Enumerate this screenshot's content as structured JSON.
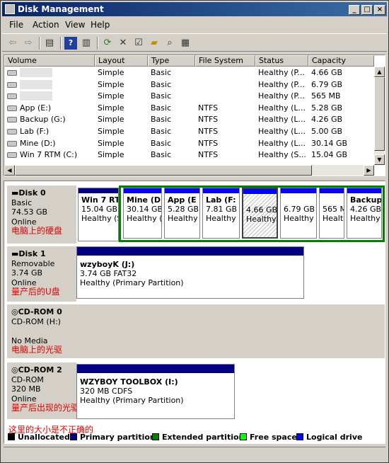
{
  "window": {
    "title": "Disk Management",
    "controls": [
      "_",
      "□",
      "×"
    ]
  },
  "menu": [
    "File",
    "Action",
    "View",
    "Help"
  ],
  "toolbar": [
    "back-arrow-icon",
    "forward-arrow-icon",
    "console-tree-icon",
    "help-icon",
    "properties-pane-icon",
    "refresh-icon",
    "delete-icon",
    "properties-icon",
    "open-folder-icon",
    "search-icon",
    "settings-icon"
  ],
  "columns": [
    "Volume",
    "Layout",
    "Type",
    "File System",
    "Status",
    "Capacity"
  ],
  "volumes": [
    {
      "name": "",
      "layout": "Simple",
      "type": "Basic",
      "fs": "",
      "status": "Healthy (P...",
      "capacity": "4.66 GB"
    },
    {
      "name": "",
      "layout": "Simple",
      "type": "Basic",
      "fs": "",
      "status": "Healthy (P...",
      "capacity": "6.79 GB"
    },
    {
      "name": "",
      "layout": "Simple",
      "type": "Basic",
      "fs": "",
      "status": "Healthy (P...",
      "capacity": "565 MB"
    },
    {
      "name": "App (E:)",
      "layout": "Simple",
      "type": "Basic",
      "fs": "NTFS",
      "status": "Healthy (L...",
      "capacity": "5.28 GB"
    },
    {
      "name": "Backup (G:)",
      "layout": "Simple",
      "type": "Basic",
      "fs": "NTFS",
      "status": "Healthy (L...",
      "capacity": "4.26 GB"
    },
    {
      "name": "Lab (F:)",
      "layout": "Simple",
      "type": "Basic",
      "fs": "NTFS",
      "status": "Healthy (L...",
      "capacity": "5.00 GB"
    },
    {
      "name": "Mine (D:)",
      "layout": "Simple",
      "type": "Basic",
      "fs": "NTFS",
      "status": "Healthy (L...",
      "capacity": "30.14 GB"
    },
    {
      "name": "Win 7 RTM (C:)",
      "layout": "Simple",
      "type": "Basic",
      "fs": "NTFS",
      "status": "Healthy (S...",
      "capacity": "15.04 GB"
    }
  ],
  "disks": [
    {
      "name": "Disk 0",
      "l1": "Basic",
      "l2": "74.53 GB",
      "l3": "Online",
      "note": "电脑上的硬盘",
      "parts": [
        {
          "t1": "Win 7 RT",
          "t2": "15.04 GB",
          "t3": "Healthy (S"
        },
        {
          "t1": "Mine (D",
          "t2": "30.14 GB",
          "t3": "Healthy (L"
        },
        {
          "t1": "App (E",
          "t2": "5.28 GB",
          "t3": "Healthy"
        },
        {
          "t1": "Lab (F:",
          "t2": "7.81 GB",
          "t3": "Healthy ("
        },
        {
          "t1": "",
          "t2": "4.66 GB",
          "t3": "Healthy"
        },
        {
          "t1": "",
          "t2": "6.79 GB",
          "t3": "Healthy"
        },
        {
          "t1": "",
          "t2": "565 M",
          "t3": "Healt"
        },
        {
          "t1": "Backup",
          "t2": "4.26 GB",
          "t3": "Healthy"
        }
      ]
    },
    {
      "name": "Disk 1",
      "l1": "Removable",
      "l2": "3.74 GB",
      "l3": "Online",
      "note": "量产后的U盘",
      "parts": [
        {
          "t1": "wzyboyK  (J:)",
          "t2": "3.74 GB FAT32",
          "t3": "Healthy (Primary Partition)"
        }
      ]
    },
    {
      "name": "CD-ROM 0",
      "l1": "CD-ROM (H:)",
      "l2": "",
      "l3": "No Media",
      "note": "电脑上的光驱",
      "parts": []
    },
    {
      "name": "CD-ROM 2",
      "l1": "CD-ROM",
      "l2": "320 MB",
      "l3": "Online",
      "note": "量产后出现的光驱",
      "note2": "这里的大小是不正确的",
      "parts": [
        {
          "t1": "WZYBOY TOOLBOX (I:)",
          "t2": "320 MB CDFS",
          "t3": "Healthy (Primary Partition)"
        }
      ]
    }
  ],
  "legend": [
    {
      "label": "Unallocated",
      "color": "#000000"
    },
    {
      "label": "Primary partition",
      "color": "#000080"
    },
    {
      "label": "Extended partition",
      "color": "#008000"
    },
    {
      "label": "Free space",
      "color": "#00ff00"
    },
    {
      "label": "Logical drive",
      "color": "#0000ff"
    }
  ]
}
